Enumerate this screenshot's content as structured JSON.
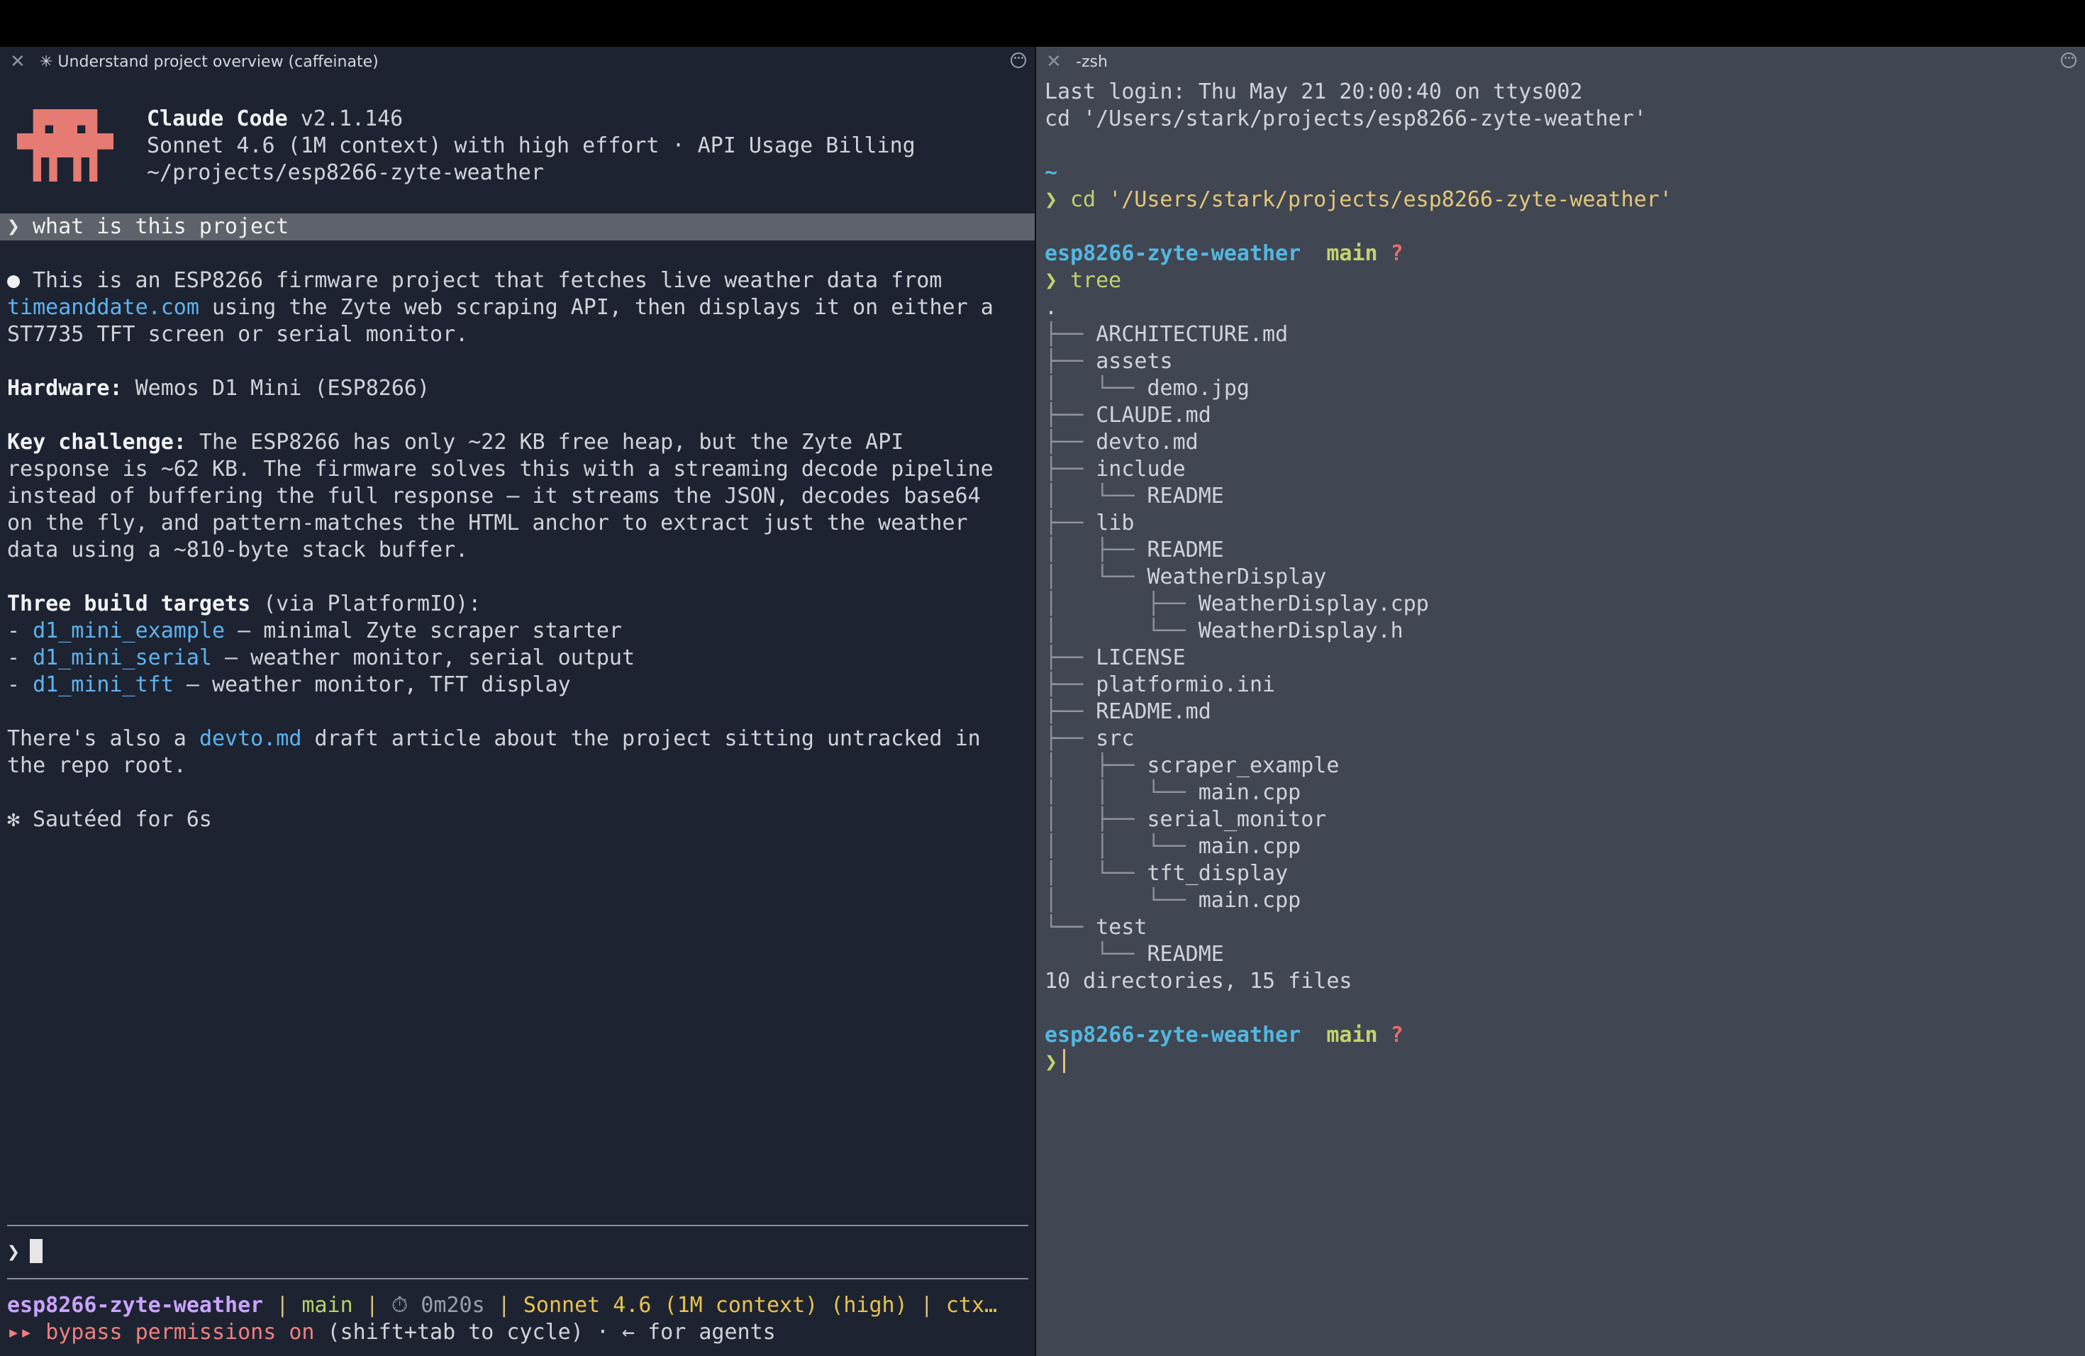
{
  "left": {
    "tab_title": "✳ Understand project overview (caffeinate)",
    "header": {
      "app_name": "Claude Code",
      "version": "v2.1.146",
      "model_line": "Sonnet 4.6 (1M context) with high effort · API Usage Billing",
      "path": "~/projects/esp8266-zyte-weather"
    },
    "user_prompt": "what is this project",
    "response": {
      "p1_a": "This is an ESP8266 firmware project that fetches live weather data from",
      "p1_link": "timeanddate.com",
      "p1_b": " using the Zyte web scraping API, then displays it on either a",
      "p1_c": "ST7735 TFT screen or serial monitor.",
      "hw_label": "Hardware:",
      "hw_value": " Wemos D1 Mini (ESP8266)",
      "kc_label": "Key challenge:",
      "kc_1": " The ESP8266 has only ~22 KB free heap, but the Zyte API",
      "kc_2": "response is ~62 KB. The firmware solves this with a streaming decode pipeline",
      "kc_3": "instead of buffering the full response — it streams the JSON, decodes base64",
      "kc_4": "on the fly, and pattern-matches the HTML anchor to extract just the weather",
      "kc_5": "data using a ~810-byte stack buffer.",
      "tb_label": "Three build targets",
      "tb_value": " (via PlatformIO):",
      "targets": [
        {
          "name": "d1_mini_example",
          "desc": " — minimal Zyte scraper starter"
        },
        {
          "name": "d1_mini_serial",
          "desc": " — weather monitor, serial output"
        },
        {
          "name": "d1_mini_tft",
          "desc": " — weather monitor, TFT display"
        }
      ],
      "last_a": "There's also a ",
      "last_link": "devto.md",
      "last_b": " draft article about the project sitting untracked in",
      "last_c": "the repo root."
    },
    "timing": "Sautéed for 6s",
    "status": {
      "project": "esp8266-zyte-weather",
      "branch": "main",
      "elapsed": "0m20s",
      "model": "Sonnet 4.6 (1M context) (high)",
      "ctx": "ctx…",
      "perm_prefix": "▸▸",
      "perm_text": "bypass permissions on",
      "perm_hint": " (shift+tab to cycle) · ← for agents"
    }
  },
  "right": {
    "tab_title": "-zsh",
    "last_login": "Last login: Thu May 21 20:00:40 on ttys002",
    "cd_line": "cd '/Users/stark/projects/esp8266-zyte-weather'",
    "home_dir": "~",
    "cd_cmd": "cd",
    "cd_arg": "'/Users/stark/projects/esp8266-zyte-weather'",
    "prompt_dir": "esp8266-zyte-weather",
    "prompt_branch": "main",
    "prompt_status": "?",
    "tree_cmd": "tree",
    "tree_root": ".",
    "tree": [
      {
        "g": "├── ",
        "t": "ARCHITECTURE.md"
      },
      {
        "g": "├── ",
        "t": "assets"
      },
      {
        "g": "│   └── ",
        "t": "demo.jpg"
      },
      {
        "g": "├── ",
        "t": "CLAUDE.md"
      },
      {
        "g": "├── ",
        "t": "devto.md"
      },
      {
        "g": "├── ",
        "t": "include"
      },
      {
        "g": "│   └── ",
        "t": "README"
      },
      {
        "g": "├── ",
        "t": "lib"
      },
      {
        "g": "│   ├── ",
        "t": "README"
      },
      {
        "g": "│   └── ",
        "t": "WeatherDisplay"
      },
      {
        "g": "│       ├── ",
        "t": "WeatherDisplay.cpp"
      },
      {
        "g": "│       └── ",
        "t": "WeatherDisplay.h"
      },
      {
        "g": "├── ",
        "t": "LICENSE"
      },
      {
        "g": "├── ",
        "t": "platformio.ini"
      },
      {
        "g": "├── ",
        "t": "README.md"
      },
      {
        "g": "├── ",
        "t": "src"
      },
      {
        "g": "│   ├── ",
        "t": "scraper_example"
      },
      {
        "g": "│   │   └── ",
        "t": "main.cpp"
      },
      {
        "g": "│   ├── ",
        "t": "serial_monitor"
      },
      {
        "g": "│   │   └── ",
        "t": "main.cpp"
      },
      {
        "g": "│   └── ",
        "t": "tft_display"
      },
      {
        "g": "│       └── ",
        "t": "main.cpp"
      },
      {
        "g": "└── ",
        "t": "test"
      },
      {
        "g": "    └── ",
        "t": "README"
      }
    ],
    "tree_summary": "10 directories, 15 files"
  }
}
